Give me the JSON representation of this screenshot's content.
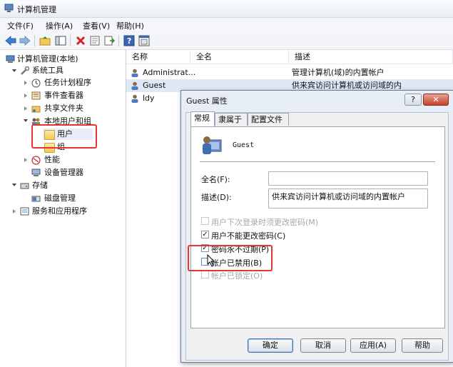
{
  "window": {
    "title": "计算机管理"
  },
  "menu": [
    "文件(F)",
    "操作(A)",
    "查看(V)",
    "帮助(H)"
  ],
  "toolbar": {
    "icons": [
      "back-arrow-icon",
      "forward-arrow-icon",
      "up-folder-icon",
      "show-tree-icon",
      "delete-icon",
      "properties-icon",
      "export-icon",
      "help-icon",
      "console-icon"
    ]
  },
  "tree": {
    "root": "计算机管理(本地)",
    "system_tools": "系统工具",
    "task_scheduler": "任务计划程序",
    "event_viewer": "事件查看器",
    "shared_folders": "共享文件夹",
    "local_users_groups": "本地用户和组",
    "users": "用户",
    "groups": "组",
    "performance": "性能",
    "device_manager": "设备管理器",
    "storage": "存储",
    "disk_management": "磁盘管理",
    "services_apps": "服务和应用程序"
  },
  "list": {
    "columns": [
      "名称",
      "全名",
      "描述"
    ],
    "rows": [
      {
        "name": "Administrat...",
        "fullname": "",
        "desc": "管理计算机(域)的内置帐户"
      },
      {
        "name": "Guest",
        "fullname": "",
        "desc": "供来宾访问计算机或访问域的内"
      },
      {
        "name": "ldy",
        "fullname": "",
        "desc": ""
      }
    ]
  },
  "dialog": {
    "title": "Guest 属性",
    "help_btn": "?",
    "close_btn": "✕",
    "tabs": [
      "常规",
      "隶属于",
      "配置文件"
    ],
    "user_name": "Guest",
    "fullname_label": "全名(F):",
    "fullname_value": "",
    "desc_label": "描述(D):",
    "desc_value": "供来宾访问计算机或访问域的内置帐户",
    "checkboxes": [
      {
        "label": "用户下次登录时须更改密码(M)",
        "checked": false,
        "disabled": true
      },
      {
        "label": "用户不能更改密码(C)",
        "checked": true,
        "disabled": false
      },
      {
        "label": "密码永不过期(P)",
        "checked": true,
        "disabled": false
      },
      {
        "label": "帐户已禁用(B)",
        "checked": false,
        "disabled": false
      },
      {
        "label": "帐户已锁定(O)",
        "checked": false,
        "disabled": true
      }
    ],
    "buttons": {
      "ok": "确定",
      "cancel": "取消",
      "apply": "应用(A)",
      "help": "帮助"
    }
  },
  "colors": {
    "highlight": "#e63333",
    "selection": "#dfe8f5",
    "dialog_frame": "#e6edf6"
  }
}
